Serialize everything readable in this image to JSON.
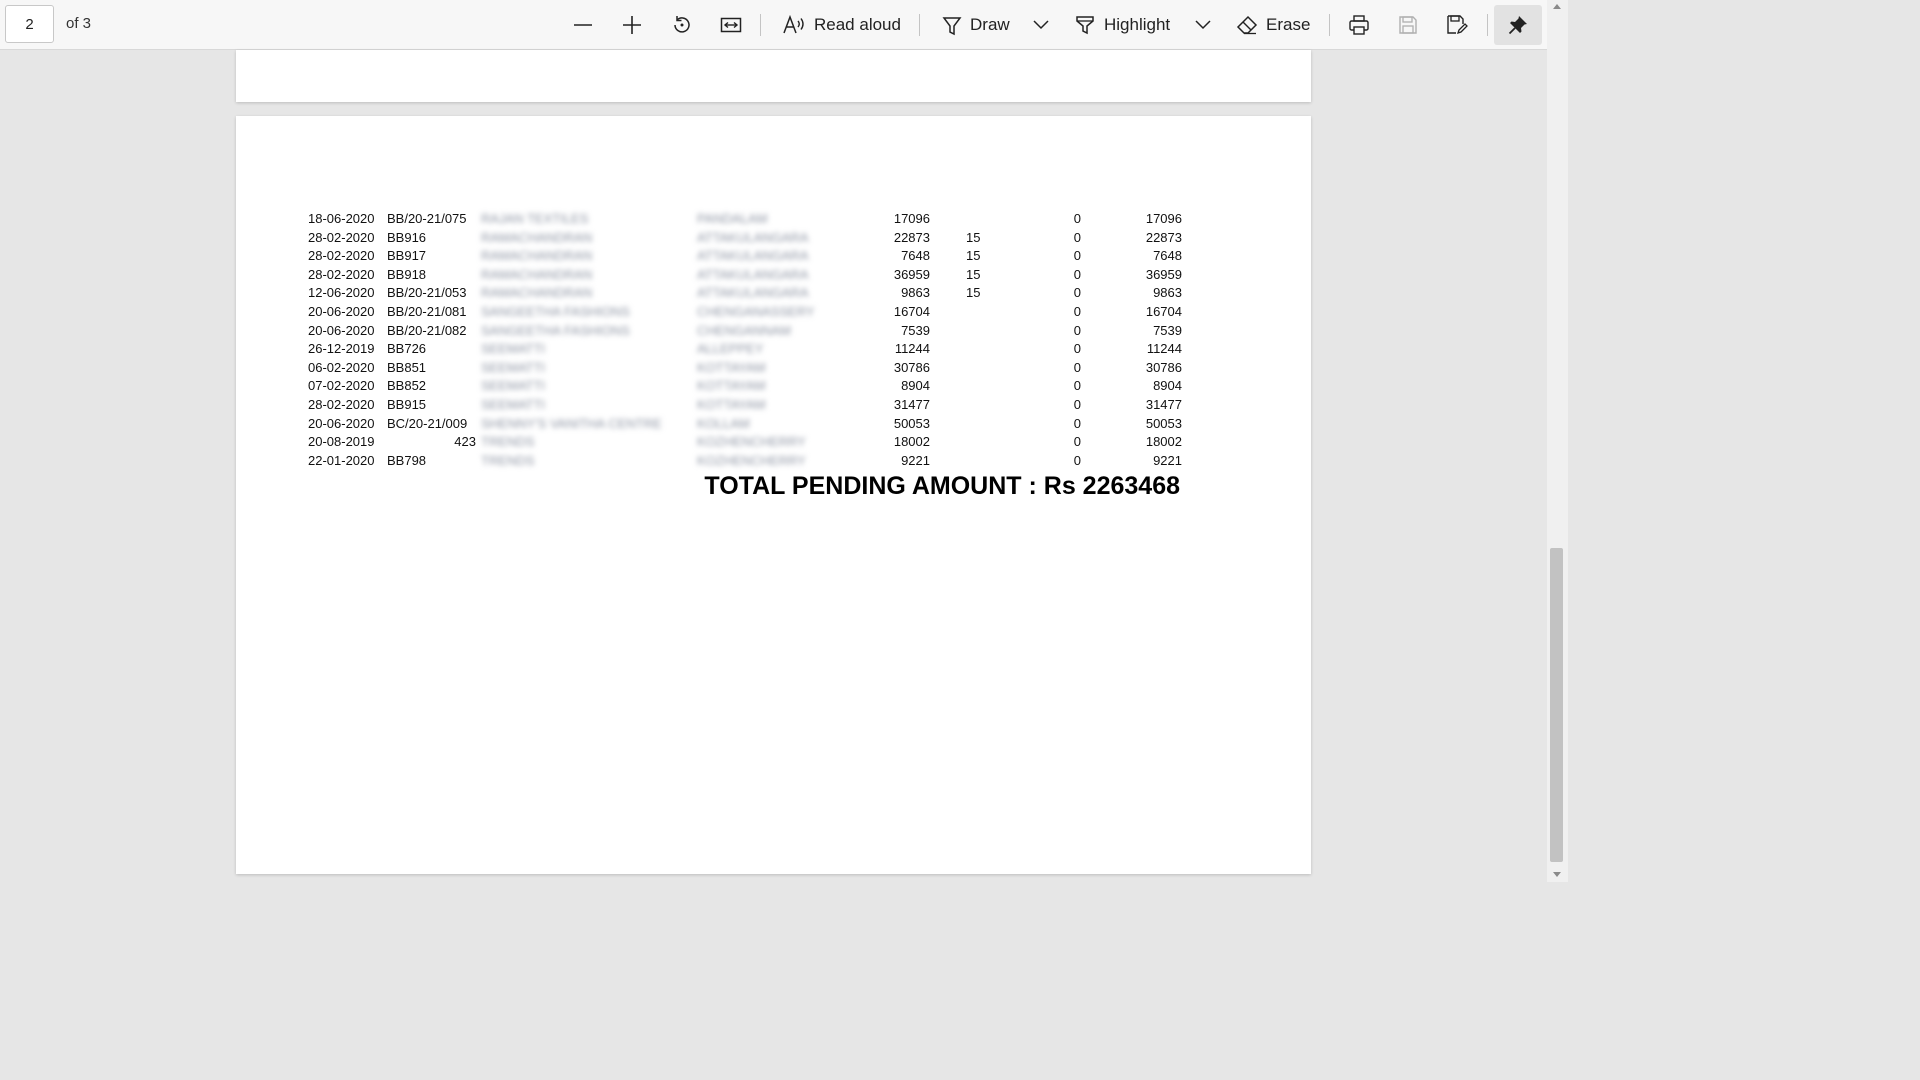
{
  "toolbar": {
    "page_number": "2",
    "page_of": "of 3",
    "read_aloud_label": "Read aloud",
    "draw_label": "Draw",
    "highlight_label": "Highlight",
    "erase_label": "Erase",
    "icons": [
      "zoom-out-icon",
      "zoom-in-icon",
      "rotate-icon",
      "fit-width-icon",
      "read-aloud-icon",
      "draw-icon",
      "chevron-down-icon",
      "highlight-icon",
      "erase-icon",
      "print-icon",
      "save-icon",
      "save-as-icon",
      "pin-icon"
    ]
  },
  "document": {
    "rows": [
      {
        "date": "18-06-2020",
        "bill": "BB/20-21/075",
        "name": "RAJAN TEXTILES",
        "place": "PANDALAM",
        "amount": "17096",
        "days": "",
        "received": "0",
        "balance": "17096"
      },
      {
        "date": "28-02-2020",
        "bill": "BB916",
        "name": "RAMACHANDRAN",
        "place": "ATTAKULANGARA",
        "amount": "22873",
        "days": "15",
        "received": "0",
        "balance": "22873"
      },
      {
        "date": "28-02-2020",
        "bill": "BB917",
        "name": "RAMACHANDRAN",
        "place": "ATTAKULANGARA",
        "amount": "7648",
        "days": "15",
        "received": "0",
        "balance": "7648"
      },
      {
        "date": "28-02-2020",
        "bill": "BB918",
        "name": "RAMACHANDRAN",
        "place": "ATTAKULANGARA",
        "amount": "36959",
        "days": "15",
        "received": "0",
        "balance": "36959"
      },
      {
        "date": "12-06-2020",
        "bill": "BB/20-21/053",
        "name": "RAMACHANDRAN",
        "place": "ATTAKULANGARA",
        "amount": "9863",
        "days": "15",
        "received": "0",
        "balance": "9863"
      },
      {
        "date": "20-06-2020",
        "bill": "BB/20-21/081",
        "name": "SANGEETHA FASHIONS",
        "place": "CHENGANASSERY",
        "amount": "16704",
        "days": "",
        "received": "0",
        "balance": "16704"
      },
      {
        "date": "20-06-2020",
        "bill": "BB/20-21/082",
        "name": "SANGEETHA FASHIONS",
        "place": "CHENGANNAM",
        "amount": "7539",
        "days": "",
        "received": "0",
        "balance": "7539"
      },
      {
        "date": "26-12-2019",
        "bill": "BB726",
        "name": "SEEMATTI",
        "place": "ALLEPPEY",
        "amount": "11244",
        "days": "",
        "received": "0",
        "balance": "11244"
      },
      {
        "date": "06-02-2020",
        "bill": "BB851",
        "name": "SEEMATTI",
        "place": "KOTTAYAM",
        "amount": "30786",
        "days": "",
        "received": "0",
        "balance": "30786"
      },
      {
        "date": "07-02-2020",
        "bill": "BB852",
        "name": "SEEMATTI",
        "place": "KOTTAYAM",
        "amount": "8904",
        "days": "",
        "received": "0",
        "balance": "8904"
      },
      {
        "date": "28-02-2020",
        "bill": "BB915",
        "name": "SEEMATTI",
        "place": "KOTTAYAM",
        "amount": "31477",
        "days": "",
        "received": "0",
        "balance": "31477"
      },
      {
        "date": "20-06-2020",
        "bill": "BC/20-21/009",
        "name": "SHENNY'S VANITHA CENTRE",
        "place": "KOLLAM",
        "amount": "50053",
        "days": "",
        "received": "0",
        "balance": "50053"
      },
      {
        "date": "20-08-2019",
        "bill": "423",
        "name": "TRENDS",
        "place": "KOZHENCHERRY",
        "amount": "18002",
        "days": "",
        "received": "0",
        "balance": "18002"
      },
      {
        "date": "22-01-2020",
        "bill": "BB798",
        "name": "TRENDS",
        "place": "KOZHENCHERRY",
        "amount": "9221",
        "days": "",
        "received": "0",
        "balance": "9221"
      }
    ],
    "total_label": "TOTAL PENDING AMOUNT : Rs 2263468"
  }
}
